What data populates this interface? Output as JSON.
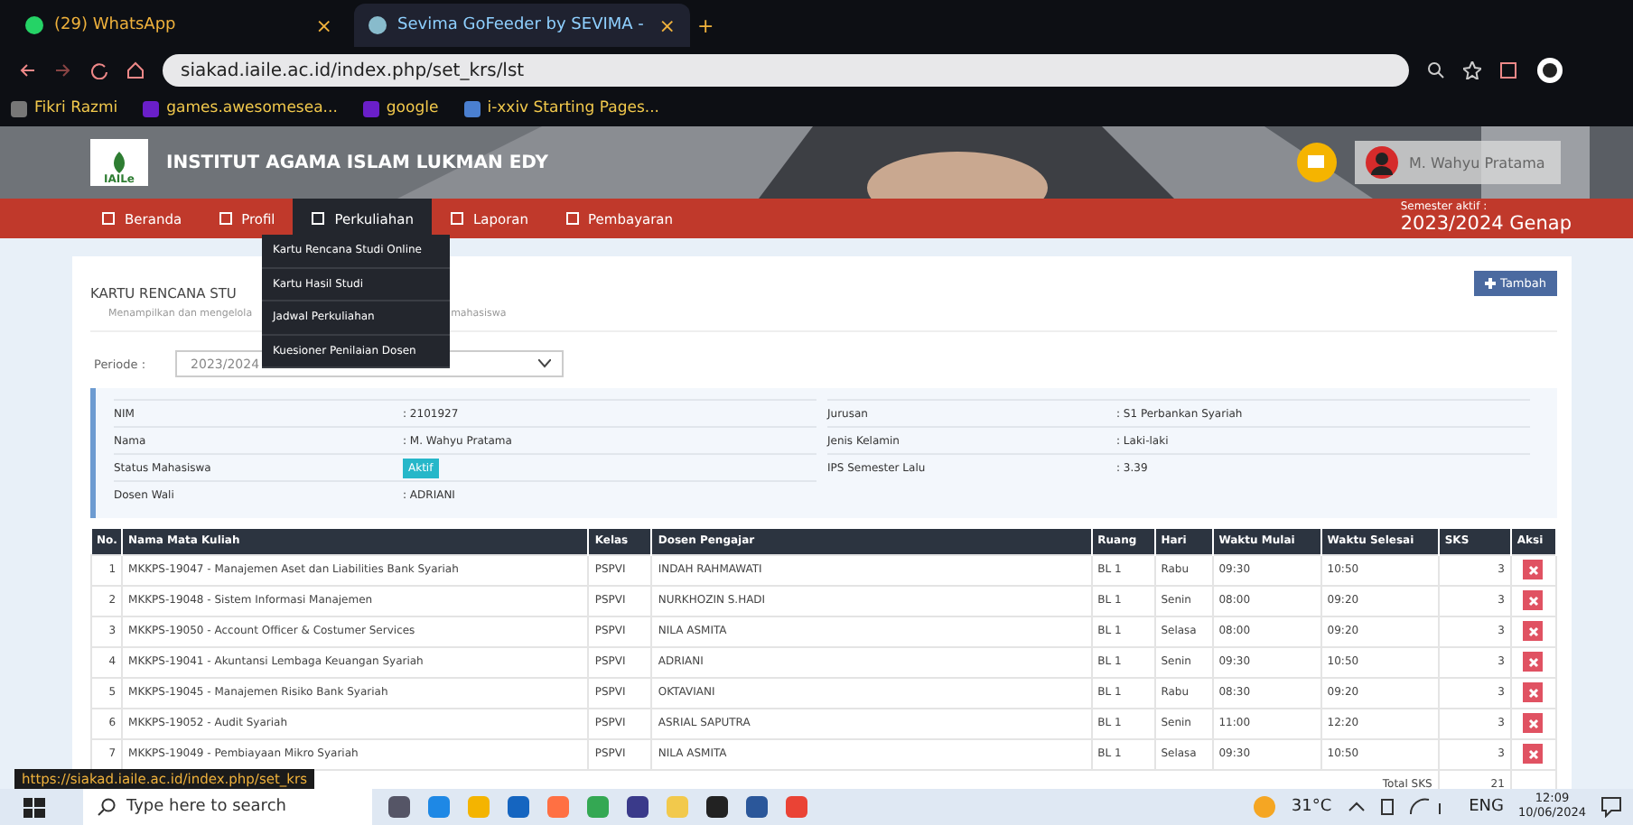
{
  "browser": {
    "tabs": [
      {
        "title": "(29) WhatsApp",
        "close": "×",
        "selected": false
      },
      {
        "title": "Sevima GoFeeder by SEVIMA -",
        "close": "×",
        "selected": true
      }
    ],
    "new_tab": "+",
    "url": "siakad.iaile.ac.id/index.php/set_krs/lst",
    "bookmarks": [
      "Fikri Razmi",
      "games.awesomesea...",
      "google",
      "i-xxiv Starting Pages..."
    ],
    "status_link": "https://siakad.iaile.ac.id/index.php/set_krs"
  },
  "site": {
    "logo_text": "IAILe",
    "institution": "INSTITUT AGAMA ISLAM LUKMAN EDY",
    "user_name": "M. Wahyu Pratama",
    "nav": [
      {
        "label": "Beranda",
        "selected": false
      },
      {
        "label": "Profil",
        "selected": false
      },
      {
        "label": "Perkuliahan",
        "selected": true
      },
      {
        "label": "Laporan",
        "selected": false
      },
      {
        "label": "Pembayaran",
        "selected": false
      }
    ],
    "dropdown": [
      "Kartu Rencana Studi Online",
      "Kartu Hasil Studi",
      "Jadwal Perkuliahan",
      "Kuesioner Penilaian Dosen"
    ],
    "semester_label": "Semester aktif :",
    "semester_value": "2023/2024 Genap"
  },
  "page": {
    "title": "KARTU RENCANA STU",
    "subtitle_start": "Menampilkan dan mengelola",
    "subtitle_end": "mahasiswa",
    "add_button": "Tambah",
    "period_label": "Periode :",
    "period_value": "2023/2024",
    "info_left": [
      {
        "label": "NIM",
        "value": ": 2101927"
      },
      {
        "label": "Nama",
        "value": ": M. Wahyu Pratama"
      },
      {
        "label": "Status Mahasiswa",
        "value": "Aktif",
        "kind": "badge"
      },
      {
        "label": "Dosen Wali",
        "value": ": ADRIANI"
      }
    ],
    "info_right": [
      {
        "label": "Jurusan",
        "value": ": S1 Perbankan Syariah"
      },
      {
        "label": "Jenis Kelamin",
        "value": ": Laki-laki"
      },
      {
        "label": "IPS Semester Lalu",
        "value": ": 3.39"
      }
    ]
  },
  "table": {
    "columns": [
      "No.",
      "Nama Mata Kuliah",
      "Kelas",
      "Dosen Pengajar",
      "Ruang",
      "Hari",
      "Waktu Mulai",
      "Waktu Selesai",
      "SKS",
      "Aksi"
    ],
    "rows": [
      [
        "1",
        "MKKPS-19047 - Manajemen Aset dan Liabilities Bank Syariah",
        "PSPVI",
        "INDAH RAHMAWATI",
        "BL 1",
        "Rabu",
        "09:30",
        "10:50",
        "3"
      ],
      [
        "2",
        "MKKPS-19048 - Sistem Informasi Manajemen",
        "PSPVI",
        "NURKHOZIN S.HADI",
        "BL 1",
        "Senin",
        "08:00",
        "09:20",
        "3"
      ],
      [
        "3",
        "MKKPS-19050 - Account Officer & Costumer Services",
        "PSPVI",
        "NILA ASMITA",
        "BL 1",
        "Selasa",
        "08:00",
        "09:20",
        "3"
      ],
      [
        "4",
        "MKKPS-19041 - Akuntansi Lembaga Keuangan Syariah",
        "PSPVI",
        "ADRIANI",
        "BL 1",
        "Senin",
        "09:30",
        "10:50",
        "3"
      ],
      [
        "5",
        "MKKPS-19045 - Manajemen Risiko Bank Syariah",
        "PSPVI",
        "OKTAVIANI",
        "BL 1",
        "Rabu",
        "08:30",
        "09:20",
        "3"
      ],
      [
        "6",
        "MKKPS-19052 - Audit Syariah",
        "PSPVI",
        "ASRIAL SAPUTRA",
        "BL 1",
        "Senin",
        "11:00",
        "12:20",
        "3"
      ],
      [
        "7",
        "MKKPS-19049 - Pembiayaan Mikro Syariah",
        "PSPVI",
        "NILA ASMITA",
        "BL 1",
        "Selasa",
        "09:30",
        "10:50",
        "3"
      ]
    ],
    "total_label": "Total SKS",
    "total_value": "21"
  },
  "taskbar": {
    "search_placeholder": "Type here to search",
    "weather": "31°C",
    "language": "ENG",
    "time": "12:09",
    "date": "10/06/2024"
  }
}
